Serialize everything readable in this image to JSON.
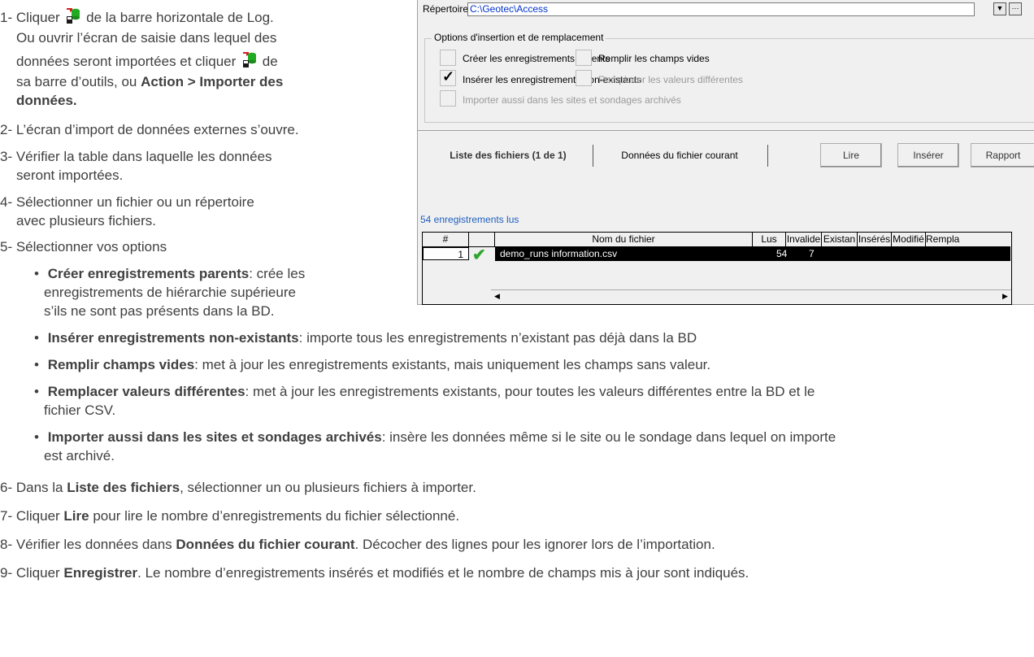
{
  "instructions": {
    "step1_a": "1- Cliquer",
    "step1_b": "de la barre horizontale de Log.",
    "step1_line2": "Ou ouvrir l’écran de saisie dans lequel des",
    "step1_line3_a": "données seront importées et cliquer",
    "step1_line3_b": "de",
    "step1_line4_a": "sa barre d’outils, ou ",
    "step1_line4_b": "Action > Importer des",
    "step1_line5": "données.",
    "step2": "2- L’écran d’import de données externes s’ouvre.",
    "step3_line1": "3- Vérifier la table dans laquelle les données",
    "step3_line2": "seront importées.",
    "step4_line1": "4- Sélectionner un fichier ou un répertoire",
    "step4_line2": "avec plusieurs fichiers.",
    "step5": "5- Sélectionner vos options",
    "opt1_bold": "Créer enregistrements parents",
    "opt1_text_1": ": crée les",
    "opt1_text_2": "enregistrements de hiérarchie supérieure",
    "opt1_text_3": "s’ils ne sont pas présents dans la BD.",
    "opt2_bold": "Insérer enregistrements non-existants",
    "opt2_text": ": importe tous les enregistrements n’existant pas déjà dans la BD",
    "opt3_bold": "Remplir champs vides",
    "opt3_text": ": met à jour les enregistrements existants, mais uniquement les champs sans valeur.",
    "opt4_bold": "Remplacer valeurs différentes",
    "opt4_text": ": met à jour les enregistrements existants, pour toutes les valeurs différentes entre la BD et le",
    "opt4_text_2": "fichier CSV.",
    "opt5_bold": "Importer aussi dans les sites et sondages archivés",
    "opt5_text": ": insère les données même si le site ou le sondage dans lequel on importe",
    "opt5_text_2": "est archivé.",
    "step6_a": "6- Dans la ",
    "step6_b": "Liste des fichiers",
    "step6_c": ", sélectionner un ou plusieurs fichiers à importer.",
    "step7_a": "7- Cliquer ",
    "step7_b": "Lire",
    "step7_c": " pour lire le nombre d’enregistrements du fichier sélectionné.",
    "step8_a": "8- Vérifier les données dans ",
    "step8_b": "Données du fichier courant",
    "step8_c": ". Décocher des lignes pour les ignorer lors de l’importation.",
    "step9_a": "9- Cliquer ",
    "step9_b": "Enregistrer",
    "step9_c": ". Le nombre d’enregistrements insérés et modifiés et le nombre de champs mis à jour sont indiqués."
  },
  "dialog": {
    "dir_label": "Répertoire:",
    "dir_value": "C:\\Geotec\\Access",
    "options_legend": "Options d'insertion et de remplacement",
    "opt_create_parents": "Créer les enregistrements parents",
    "opt_insert_nonexisting": "Insérer les enregistrements non-existants",
    "opt_import_archived": "Importer aussi dans les sites et sondages archivés",
    "opt_fill_empty": "Remplir les champs vides",
    "opt_replace_diff": "Remplacer les valeurs différentes",
    "insert_checked_mark": "✓",
    "tab_files": "Liste des fichiers (1 de 1)",
    "tab_current": "Données du fichier courant",
    "btn_read": "Lire",
    "btn_insert": "Insérer",
    "btn_report": "Rapport",
    "status": "54 enregistrements lus",
    "grid_headers": [
      "#",
      "",
      "Nom du fichier",
      "Lus",
      "Invalide",
      "Existan",
      "Insérés",
      "Modifié",
      "Rempla"
    ],
    "row": {
      "num": "1",
      "ok": "✔",
      "file": "demo_runs information.csv",
      "lus": "54",
      "invalide": "7"
    }
  },
  "colors": {
    "accent_link": "#1f5fbf",
    "dir_text": "#0033cc",
    "check_green": "#2fa52f"
  }
}
